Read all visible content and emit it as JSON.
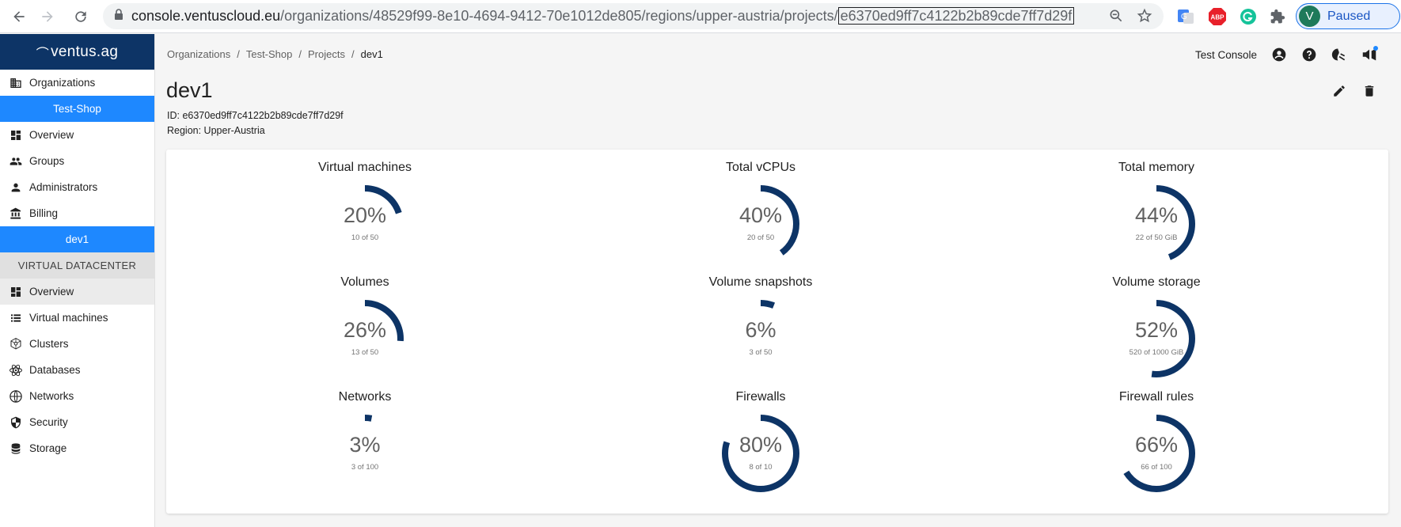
{
  "browser": {
    "url_host": "console.ventuscloud.eu",
    "url_path": "/organizations/48529f99-8e10-4694-9412-70e1012de805/regions/upper-austria/projects/",
    "url_selected": "e6370ed9ff7c4122b2b89cde7ff7d29f",
    "profile_initial": "V",
    "profile_status": "Paused",
    "ext_abp": "ABP"
  },
  "logo": {
    "text": "ventus.ag"
  },
  "sidebar": {
    "organizations": "Organizations",
    "org_name": "Test-Shop",
    "overview": "Overview",
    "groups": "Groups",
    "administrators": "Administrators",
    "billing": "Billing",
    "project_name": "dev1",
    "section_header": "VIRTUAL DATACENTER",
    "vdc_overview": "Overview",
    "virtual_machines": "Virtual machines",
    "clusters": "Clusters",
    "databases": "Databases",
    "networks": "Networks",
    "security": "Security",
    "storage": "Storage"
  },
  "breadcrumb": [
    "Organizations",
    "Test-Shop",
    "Projects",
    "dev1"
  ],
  "breadcrumb_sep": "/",
  "header": {
    "context": "Test Console"
  },
  "page": {
    "title": "dev1",
    "id_line": "ID: e6370ed9ff7c4122b2b89cde7ff7d29f",
    "region_line": "Region: Upper-Austria"
  },
  "colors": {
    "gauge": "#0d3466",
    "accent": "#1e88ff"
  },
  "gauges": [
    {
      "title": "Virtual machines",
      "percent": "20%",
      "fraction": 0.2,
      "detail": "10 of 50"
    },
    {
      "title": "Total vCPUs",
      "percent": "40%",
      "fraction": 0.4,
      "detail": "20 of 50"
    },
    {
      "title": "Total memory",
      "percent": "44%",
      "fraction": 0.44,
      "detail": "22 of 50 GiB"
    },
    {
      "title": "Volumes",
      "percent": "26%",
      "fraction": 0.26,
      "detail": "13 of 50"
    },
    {
      "title": "Volume snapshots",
      "percent": "6%",
      "fraction": 0.06,
      "detail": "3 of 50"
    },
    {
      "title": "Volume storage",
      "percent": "52%",
      "fraction": 0.52,
      "detail": "520 of 1000 GiB"
    },
    {
      "title": "Networks",
      "percent": "3%",
      "fraction": 0.03,
      "detail": "3 of 100"
    },
    {
      "title": "Firewalls",
      "percent": "80%",
      "fraction": 0.8,
      "detail": "8 of 10"
    },
    {
      "title": "Firewall rules",
      "percent": "66%",
      "fraction": 0.66,
      "detail": "66 of 100"
    }
  ]
}
